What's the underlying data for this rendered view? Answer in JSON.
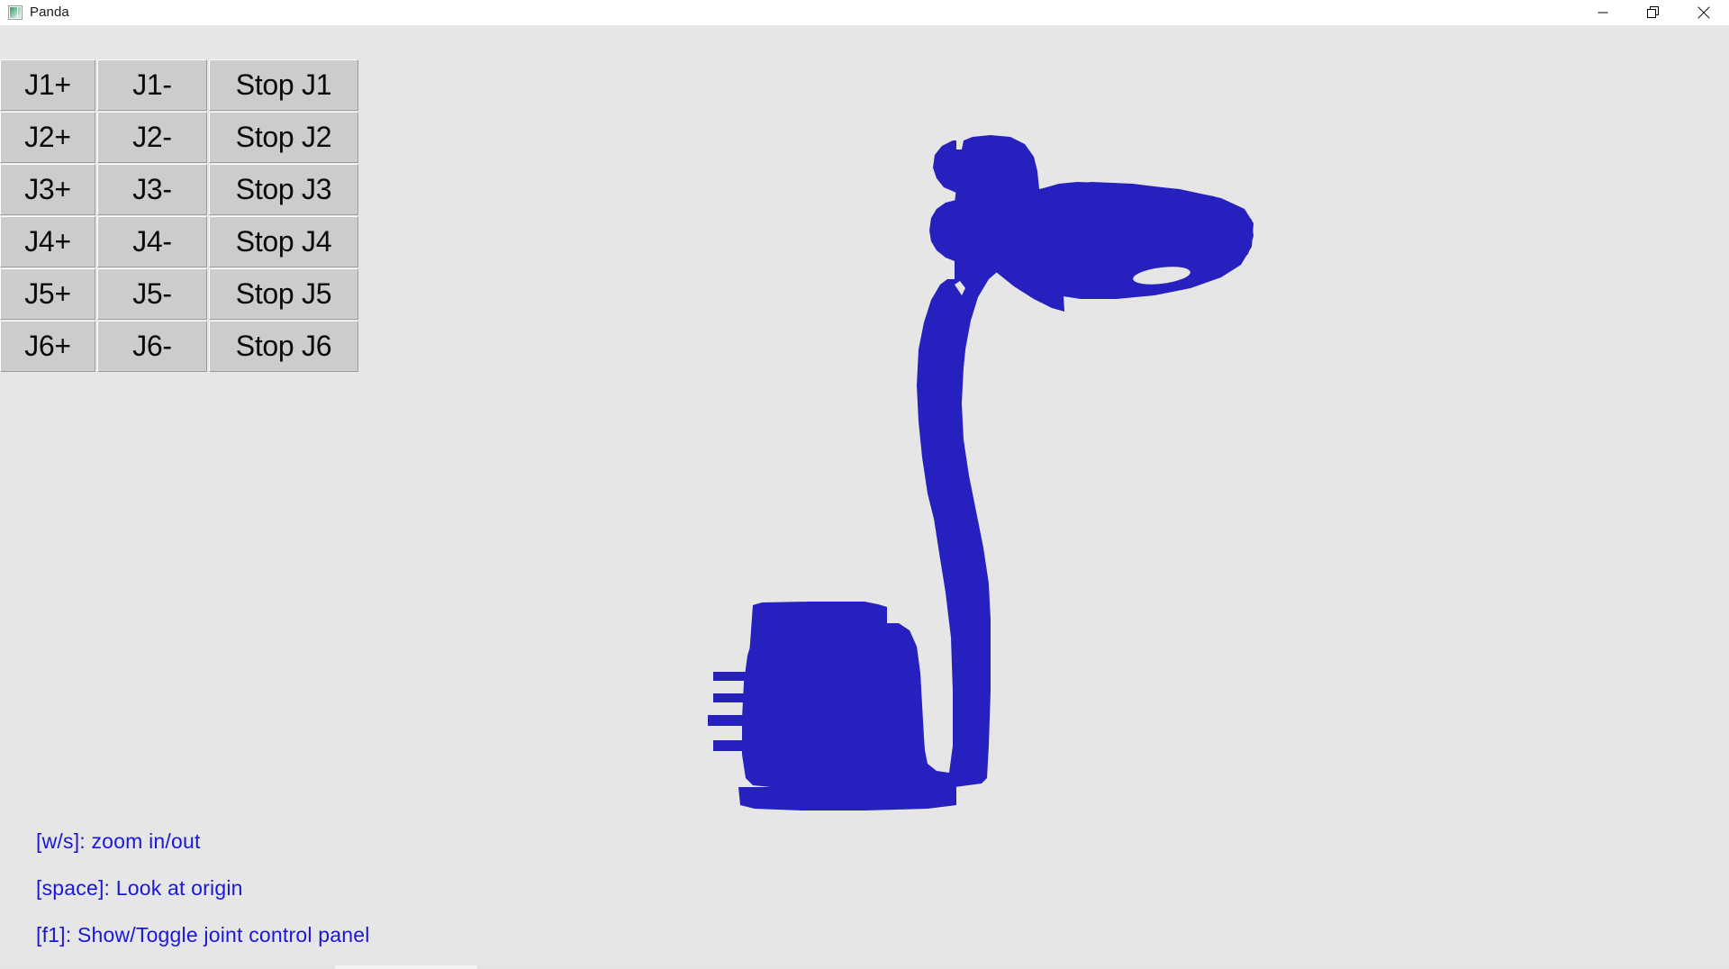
{
  "window": {
    "title": "Panda",
    "icon": "image-thumbnail-icon",
    "background_color": "#e6e6e6",
    "titlebar_color": "#ffffff",
    "controls": [
      {
        "name": "minimize",
        "glyph": "minimize-icon"
      },
      {
        "name": "restore",
        "glyph": "restore-icon"
      },
      {
        "name": "close",
        "glyph": "close-icon"
      }
    ]
  },
  "joint_panel": {
    "rows": [
      {
        "plus": "J1+",
        "minus": "J1-",
        "stop": "Stop J1"
      },
      {
        "plus": "J2+",
        "minus": "J2-",
        "stop": "Stop J2"
      },
      {
        "plus": "J3+",
        "minus": "J3-",
        "stop": "Stop J3"
      },
      {
        "plus": "J4+",
        "minus": "J4-",
        "stop": "Stop J4"
      },
      {
        "plus": "J5+",
        "minus": "J5-",
        "stop": "Stop J5"
      },
      {
        "plus": "J6+",
        "minus": "J6-",
        "stop": "Stop J6"
      }
    ],
    "button_color": "#cccccc"
  },
  "help": {
    "color": "#1a17d8",
    "lines": [
      "[w/s]: zoom in/out",
      "[space]: Look at origin",
      "[f1]: Show/Toggle joint control panel"
    ]
  },
  "scene": {
    "robot_label": "6-axis robot arm silhouette",
    "robot_color": "#2621be",
    "background_color": "#e6e6e6"
  }
}
